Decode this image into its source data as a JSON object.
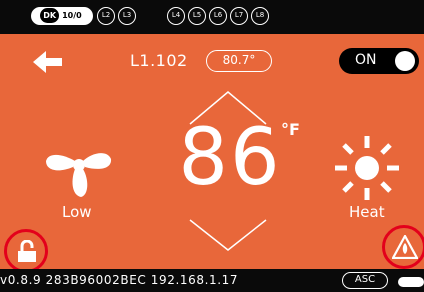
{
  "colors": {
    "background": "#e8673a",
    "bars": "#0a0a0a",
    "highlight": "#e3001b"
  },
  "top_bar": {
    "dk": "DK",
    "active_level": "10/0",
    "levels": [
      "L2",
      "L3",
      "L4",
      "L5",
      "L6",
      "L7",
      "L8"
    ]
  },
  "header": {
    "back_icon": "back-arrow-icon",
    "zone_name": "L1.102",
    "setpoint": "80.7°",
    "power_state": "ON"
  },
  "main": {
    "temperature": "86",
    "unit": "°F",
    "fan_icon": "fan-icon",
    "fan_mode": "Low",
    "mode_icon": "sun-icon",
    "mode": "Heat",
    "lock_icon": "unlocked-padlock-icon",
    "alert_icon": "warning-triangle-icon"
  },
  "bottom_bar": {
    "info": "v0.8.9 283B96002BEC 192.168.1.17",
    "asc": "ASC"
  }
}
